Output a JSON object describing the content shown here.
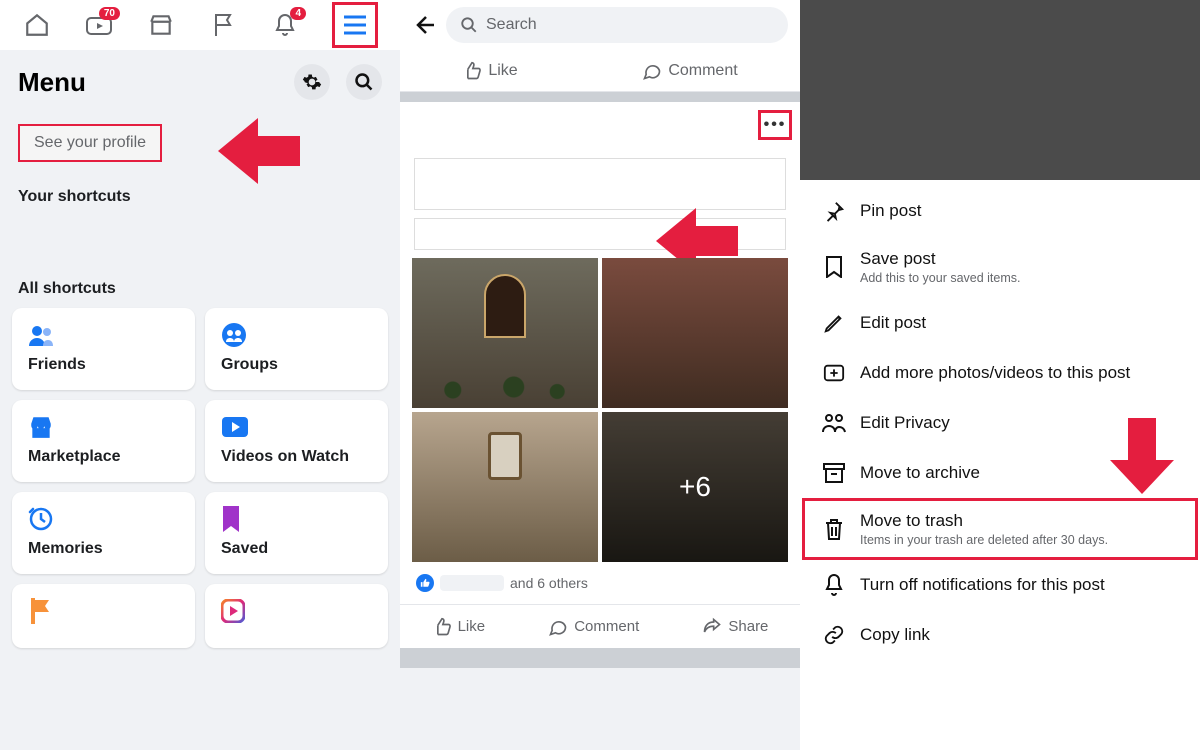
{
  "panel1": {
    "badges": {
      "watch": "70",
      "notif": "4"
    },
    "title": "Menu",
    "profile_link": "See your profile",
    "shortcuts_heading": "Your shortcuts",
    "all_shortcuts_heading": "All shortcuts",
    "cards": {
      "friends": "Friends",
      "groups": "Groups",
      "marketplace": "Marketplace",
      "videos": "Videos on Watch",
      "memories": "Memories",
      "saved": "Saved"
    }
  },
  "panel2": {
    "search_placeholder": "Search",
    "like": "Like",
    "comment": "Comment",
    "share": "Share",
    "more_overlay": "+6",
    "likes_text": "and 6 others"
  },
  "panel3": {
    "pin": "Pin post",
    "save_t": "Save post",
    "save_s": "Add this to your saved items.",
    "edit": "Edit post",
    "add_media": "Add more photos/videos to this post",
    "privacy": "Edit Privacy",
    "archive": "Move to archive",
    "trash_t": "Move to trash",
    "trash_s": "Items in your trash are deleted after 30 days.",
    "notif": "Turn off notifications for this post",
    "copy": "Copy link"
  }
}
